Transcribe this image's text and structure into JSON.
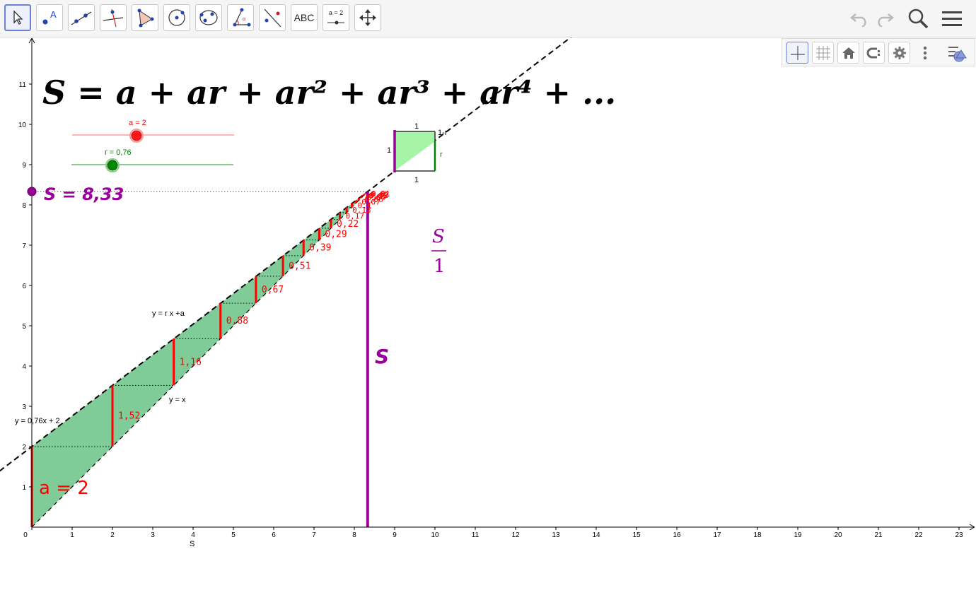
{
  "toolbar": {
    "tools": [
      {
        "name": "move-tool",
        "icon": "pointer-icon",
        "label": ""
      },
      {
        "name": "point-tool",
        "icon": "point-icon",
        "label": "A"
      },
      {
        "name": "line-tool",
        "icon": "line-icon",
        "label": ""
      },
      {
        "name": "perpendicular-tool",
        "icon": "perpendicular-icon",
        "label": ""
      },
      {
        "name": "polygon-tool",
        "icon": "polygon-icon",
        "label": ""
      },
      {
        "name": "circle-tool",
        "icon": "circle-icon",
        "label": ""
      },
      {
        "name": "conic-tool",
        "icon": "ellipse-icon",
        "label": ""
      },
      {
        "name": "angle-tool",
        "icon": "angle-icon",
        "label": ""
      },
      {
        "name": "reflect-tool",
        "icon": "reflect-icon",
        "label": ""
      },
      {
        "name": "text-tool",
        "icon": "text-icon",
        "label": "ABC"
      },
      {
        "name": "slider-tool",
        "icon": "slider-icon",
        "label": "a = 2"
      },
      {
        "name": "move-view-tool",
        "icon": "move-view-icon",
        "label": ""
      }
    ],
    "right_icons": [
      "undo-icon",
      "redo-icon",
      "search-icon",
      "menu-icon"
    ]
  },
  "stylebar": {
    "buttons": [
      "axes-icon",
      "grid-icon",
      "home-icon",
      "point-capturing-icon",
      "settings-icon",
      "more-icon",
      "style-bar-toggle-icon"
    ]
  },
  "graphics": {
    "title": "S = a + ar + ar² + ar³ + ar⁴ + ...",
    "slider_a_label": "a = 2",
    "slider_r_label": "r = 0,76",
    "sum_label": "S = 8,33",
    "line_label_1": "y = r x +a",
    "line_label_2": "y = x",
    "line_label_3": "y = 0,76x + 2",
    "a_label": "a = 2",
    "S_label": "S",
    "x_axis_name": "S",
    "frac_num": "S",
    "frac_den": "1",
    "square": {
      "top": "1",
      "left": "1",
      "bottom": "1",
      "right": "r",
      "corner": "1-r"
    },
    "colors": {
      "fill": "#80cc99",
      "term": "#ff0000",
      "sum": "#990099",
      "slider_a": "#ff0000",
      "slider_r": "#008000",
      "square_fill": "#a6f5a6"
    }
  },
  "chart_data": {
    "type": "line",
    "a": 2,
    "r": 0.76,
    "S": 8.33,
    "xlim": [
      0,
      23
    ],
    "ylim": [
      0,
      11
    ],
    "x_ticks": [
      0,
      1,
      2,
      3,
      4,
      5,
      6,
      7,
      8,
      9,
      10,
      11,
      12,
      13,
      14,
      15,
      16,
      17,
      18,
      19,
      20,
      21,
      22,
      23
    ],
    "y_ticks": [
      1,
      2,
      3,
      4,
      5,
      6,
      7,
      8,
      9,
      10,
      11
    ],
    "terms": [
      2,
      1.52,
      1.16,
      0.88,
      0.67,
      0.51,
      0.39,
      0.29,
      0.22,
      0.17,
      0.13,
      0.1,
      0.07,
      0.06,
      0.04,
      0.03,
      0.02,
      0.02,
      0.01
    ],
    "term_labels": [
      "1,52",
      "1,16",
      "0,88",
      "0,67",
      "0,51",
      "0,39",
      "0,29",
      "0,22",
      "0,17",
      "0,13",
      "0,1",
      "0,07",
      "0,06",
      "0,04",
      "0,03",
      "0,02",
      "0,02",
      "0,01"
    ],
    "series": [
      {
        "name": "y = r x +a",
        "slope": 0.76,
        "intercept": 2
      },
      {
        "name": "y = x",
        "slope": 1,
        "intercept": 0
      }
    ]
  }
}
